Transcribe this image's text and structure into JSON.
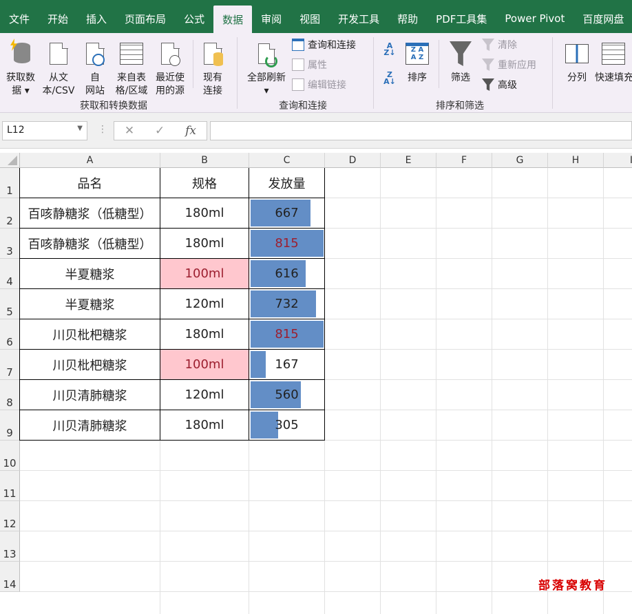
{
  "menu": {
    "tabs": [
      "文件",
      "开始",
      "插入",
      "页面布局",
      "公式",
      "数据",
      "审阅",
      "视图",
      "开发工具",
      "帮助",
      "PDF工具集",
      "Power Pivot",
      "百度网盘"
    ],
    "active": "数据"
  },
  "ribbon": {
    "get_data": "获取数\n据 ▾",
    "from_text": "从文\n本/CSV",
    "from_web": "自\n网站",
    "from_table": "来自表\n格/区域",
    "recent_sources": "最近使\n用的源",
    "existing_conn": "现有\n连接",
    "group1_name": "获取和转换数据",
    "refresh_all": "全部刷新\n▾",
    "queries_conn": "查询和连接",
    "properties": "属性",
    "edit_links": "编辑链接",
    "group2_name": "查询和连接",
    "sort": "排序",
    "filter": "筛选",
    "clear": "清除",
    "reapply": "重新应用",
    "advanced": "高级",
    "group3_name": "排序和筛选",
    "split_col": "分列",
    "flash_fill": "快速填充"
  },
  "formula_bar": {
    "name_box": "L12",
    "formula": ""
  },
  "sheet": {
    "columns": [
      "A",
      "B",
      "C",
      "D",
      "E",
      "F",
      "G",
      "H",
      "I"
    ],
    "row_numbers": [
      "1",
      "2",
      "3",
      "4",
      "5",
      "6",
      "7",
      "8",
      "9",
      "10",
      "11",
      "12",
      "13",
      "14"
    ],
    "headers": [
      "品名",
      "规格",
      "发放量"
    ],
    "rows": [
      {
        "name": "百咳静糖浆（低糖型）",
        "spec": "180ml",
        "qty": "667",
        "bar_fraction": 0.819,
        "spec_highlight": false,
        "qty_dup": false
      },
      {
        "name": "百咳静糖浆（低糖型）",
        "spec": "180ml",
        "qty": "815",
        "bar_fraction": 1.0,
        "spec_highlight": false,
        "qty_dup": true
      },
      {
        "name": "半夏糖浆",
        "spec": "100ml",
        "qty": "616",
        "bar_fraction": 0.756,
        "spec_highlight": true,
        "qty_dup": false
      },
      {
        "name": "半夏糖浆",
        "spec": "120ml",
        "qty": "732",
        "bar_fraction": 0.898,
        "spec_highlight": false,
        "qty_dup": false
      },
      {
        "name": "川贝枇杷糖浆",
        "spec": "180ml",
        "qty": "815",
        "bar_fraction": 1.0,
        "spec_highlight": false,
        "qty_dup": true
      },
      {
        "name": "川贝枇杷糖浆",
        "spec": "100ml",
        "qty": "167",
        "bar_fraction": 0.205,
        "spec_highlight": true,
        "qty_dup": false
      },
      {
        "name": "川贝清肺糖浆",
        "spec": "120ml",
        "qty": "560",
        "bar_fraction": 0.687,
        "spec_highlight": false,
        "qty_dup": false
      },
      {
        "name": "川贝清肺糖浆",
        "spec": "180ml",
        "qty": "305",
        "bar_fraction": 0.374,
        "spec_highlight": false,
        "qty_dup": false
      }
    ]
  },
  "colors": {
    "menu_bg": "#217346",
    "bar": "#638ec6",
    "highlight_fill": "#ffc7ce",
    "highlight_text": "#9c1f2f"
  },
  "watermark": "部落窝教育"
}
